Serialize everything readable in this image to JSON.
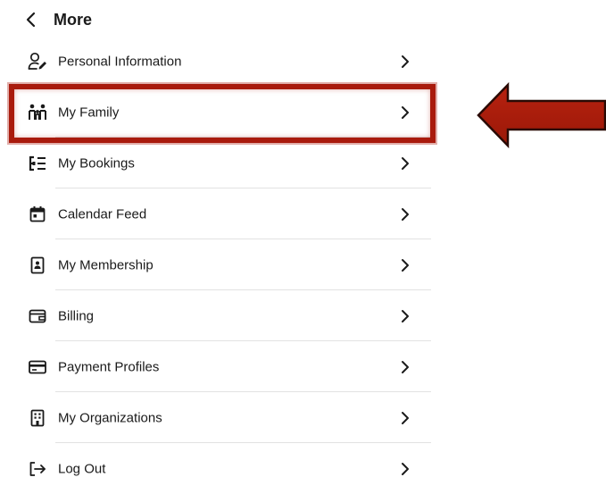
{
  "header": {
    "title": "More",
    "back_icon": "chevron-left-icon"
  },
  "menu": {
    "items": [
      {
        "id": "personal-information",
        "label": "Personal Information",
        "icon": "user-edit-icon"
      },
      {
        "id": "my-family",
        "label": "My Family",
        "icon": "family-icon"
      },
      {
        "id": "my-bookings",
        "label": "My Bookings",
        "icon": "list-icon"
      },
      {
        "id": "calendar-feed",
        "label": "Calendar Feed",
        "icon": "calendar-icon"
      },
      {
        "id": "my-membership",
        "label": "My Membership",
        "icon": "id-badge-icon"
      },
      {
        "id": "billing",
        "label": "Billing",
        "icon": "wallet-icon"
      },
      {
        "id": "payment-profiles",
        "label": "Payment Profiles",
        "icon": "credit-card-icon"
      },
      {
        "id": "my-organizations",
        "label": "My Organizations",
        "icon": "building-icon"
      },
      {
        "id": "log-out",
        "label": "Log Out",
        "icon": "logout-icon"
      }
    ],
    "chevron_icon": "chevron-right-icon"
  },
  "annotation": {
    "highlight_target": "my-family",
    "highlight_color": "#a91b0d",
    "arrow_color": "#a91b0d",
    "arrow_direction": "left"
  }
}
